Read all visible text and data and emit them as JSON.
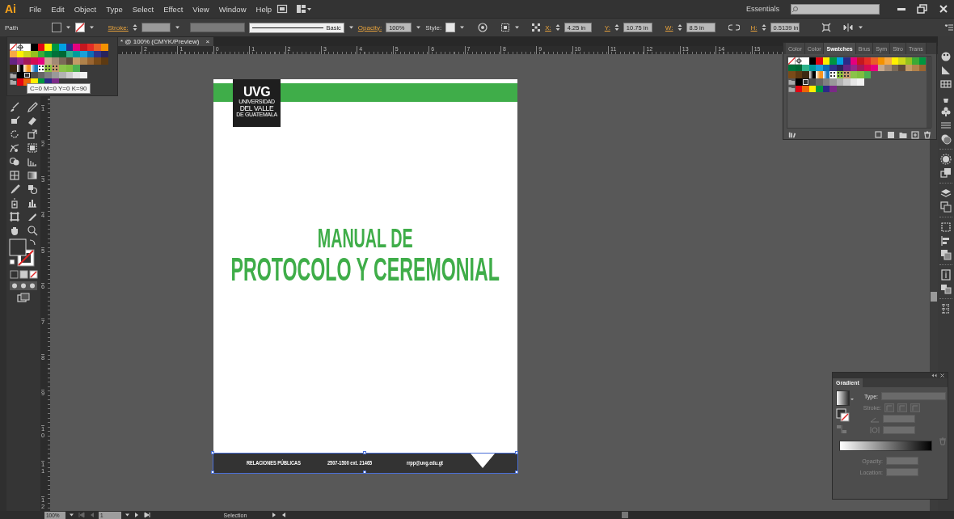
{
  "menu_bar": {
    "app_logo": "Ai",
    "items": [
      "File",
      "Edit",
      "Object",
      "Type",
      "Select",
      "Effect",
      "View",
      "Window",
      "Help"
    ],
    "workspace": "Essentials"
  },
  "control_bar": {
    "selection_type": "Path",
    "stroke_label": "Stroke:",
    "brush": "Basic",
    "opacity_label": "Opacity:",
    "opacity": "100%",
    "style_label": "Style:",
    "x_label": "X:",
    "x": "4.25 in",
    "y_label": "Y:",
    "y": "10.75 in",
    "w_label": "W:",
    "w": "8.5 in",
    "h_label": "H:",
    "h": "0.5139 in"
  },
  "document_tab": {
    "title": "* @ 100% (CMYK/Preview)",
    "close": "×"
  },
  "rulers": {
    "horizontal": [
      "2",
      "1",
      "0",
      "1",
      "2",
      "3",
      "4",
      "5",
      "6",
      "7",
      "8",
      "9",
      "10",
      "11",
      "12",
      "13",
      "14",
      "15"
    ],
    "vertical": [
      "1",
      "2",
      "3",
      "4",
      "5",
      "6",
      "7",
      "8",
      "9",
      "10",
      "11",
      "12"
    ]
  },
  "artboard": {
    "logo": {
      "initials": "UVG",
      "name_lines": [
        "UNIVERSIDAD",
        "DEL VALLE",
        "DE GUATEMALA"
      ]
    },
    "title_lines": [
      "MANUAL DE",
      "PROTOCOLO Y CEREMONIAL"
    ],
    "footer": [
      "RELACIONES PÚBLICAS",
      "2507-1500 ext. 21465",
      "rrpp@uvg.edu.gt"
    ]
  },
  "floating_swatches": {
    "rows": [
      {
        "kind": "plain",
        "swatches": [
          {
            "kind": "none",
            "selected": false
          },
          {
            "kind": "registration",
            "selected": false
          },
          {
            "kind": "solid",
            "color": "#ffffff",
            "selected": false
          },
          {
            "kind": "solid",
            "color": "#000000",
            "selected": false
          },
          {
            "kind": "solid",
            "color": "#e30613",
            "selected": false
          },
          {
            "kind": "solid",
            "color": "#ffed00",
            "selected": false
          },
          {
            "kind": "solid",
            "color": "#009640",
            "selected": false
          },
          {
            "kind": "solid",
            "color": "#00a0e3",
            "selected": false
          },
          {
            "kind": "solid",
            "color": "#2b2a87",
            "selected": false
          },
          {
            "kind": "solid",
            "color": "#e5007e",
            "selected": false
          },
          {
            "kind": "solid",
            "color": "#c5171f",
            "selected": false
          },
          {
            "kind": "solid",
            "color": "#e42d26",
            "selected": false
          },
          {
            "kind": "solid",
            "color": "#e95f27",
            "selected": false
          },
          {
            "kind": "solid",
            "color": "#f39200",
            "selected": false
          }
        ]
      },
      {
        "kind": "plain",
        "swatches": [
          {
            "kind": "solid",
            "color": "#f6a945",
            "selected": false
          },
          {
            "kind": "solid",
            "color": "#fff000",
            "selected": false
          },
          {
            "kind": "solid",
            "color": "#cdd61c",
            "selected": false
          },
          {
            "kind": "solid",
            "color": "#95c11f",
            "selected": false
          },
          {
            "kind": "solid",
            "color": "#3aaa35",
            "selected": false
          },
          {
            "kind": "solid",
            "color": "#009640",
            "selected": false
          },
          {
            "kind": "solid",
            "color": "#00713a",
            "selected": false
          },
          {
            "kind": "solid",
            "color": "#006835",
            "selected": false
          },
          {
            "kind": "solid",
            "color": "#2db28a",
            "selected": false
          },
          {
            "kind": "solid",
            "color": "#009a9b",
            "selected": false
          },
          {
            "kind": "solid",
            "color": "#1ba0d8",
            "selected": false
          },
          {
            "kind": "solid",
            "color": "#0c6db4",
            "selected": false
          },
          {
            "kind": "solid",
            "color": "#2e3289",
            "selected": false
          },
          {
            "kind": "solid",
            "color": "#29235c",
            "selected": false
          }
        ]
      },
      {
        "kind": "plain",
        "swatches": [
          {
            "kind": "solid",
            "color": "#662483",
            "selected": false
          },
          {
            "kind": "solid",
            "color": "#95278b",
            "selected": false
          },
          {
            "kind": "solid",
            "color": "#a3195b",
            "selected": false
          },
          {
            "kind": "solid",
            "color": "#d60b52",
            "selected": false
          },
          {
            "kind": "solid",
            "color": "#e6007e",
            "selected": false
          },
          {
            "kind": "solid",
            "color": "#c6a98c",
            "selected": false
          },
          {
            "kind": "solid",
            "color": "#a28a75",
            "selected": false
          },
          {
            "kind": "solid",
            "color": "#7b6a58",
            "selected": false
          },
          {
            "kind": "solid",
            "color": "#5f4b3b",
            "selected": false
          },
          {
            "kind": "solid",
            "color": "#c39a66",
            "selected": false
          },
          {
            "kind": "solid",
            "color": "#b1824b",
            "selected": false
          },
          {
            "kind": "solid",
            "color": "#9a6531",
            "selected": false
          },
          {
            "kind": "solid",
            "color": "#7a4b18",
            "selected": false
          },
          {
            "kind": "solid",
            "color": "#5d3a12",
            "selected": false
          }
        ]
      },
      {
        "kind": "plain",
        "swatches": [
          {
            "kind": "solid",
            "color": "#3d2a12",
            "selected": false
          },
          {
            "kind": "gradient",
            "color": "#000000",
            "selected": false
          },
          {
            "kind": "gradient",
            "color": "#f7941d",
            "selected": false
          },
          {
            "kind": "gradient",
            "color": "#1b75bc",
            "selected": false
          },
          {
            "kind": "pattern",
            "color": "#ffffff",
            "selected": false
          },
          {
            "kind": "pattern",
            "color": "#8dc63f",
            "selected": false
          },
          {
            "kind": "pattern",
            "color": "#c69c6d",
            "selected": false
          },
          {
            "kind": "solid",
            "color": "#8bc34a",
            "selected": false
          },
          {
            "kind": "solid",
            "color": "#7fbf3f",
            "selected": false
          },
          {
            "kind": "solid",
            "color": "#4caf50",
            "selected": false
          }
        ]
      },
      {
        "kind": "group",
        "swatches": [
          {
            "kind": "solid",
            "color": "#000000",
            "selected": false
          },
          {
            "kind": "solid",
            "color": "#333333",
            "selected": true
          },
          {
            "kind": "solid",
            "color": "#4d4d4d",
            "selected": false
          },
          {
            "kind": "solid",
            "color": "#666666",
            "selected": false
          },
          {
            "kind": "solid",
            "color": "#808080",
            "selected": false
          },
          {
            "kind": "solid",
            "color": "#999999",
            "selected": false
          },
          {
            "kind": "solid",
            "color": "#b3b3b3",
            "selected": false
          },
          {
            "kind": "solid",
            "color": "#cccccc",
            "selected": false
          },
          {
            "kind": "solid",
            "color": "#e6e6e6",
            "selected": false
          },
          {
            "kind": "solid",
            "color": "#f2f2f2",
            "selected": false
          }
        ]
      },
      {
        "kind": "group",
        "swatches": [
          {
            "kind": "solid",
            "color": "#e30613",
            "selected": false
          },
          {
            "kind": "solid",
            "color": "#ec6608",
            "selected": false
          },
          {
            "kind": "solid",
            "color": "#ffed00",
            "selected": false
          },
          {
            "kind": "solid",
            "color": "#009640",
            "selected": false
          },
          {
            "kind": "solid",
            "color": "#2b2a87",
            "selected": false
          },
          {
            "kind": "solid",
            "color": "#7b2a87",
            "selected": false
          }
        ]
      }
    ]
  },
  "tooltip": "C=0 M=0 Y=0 K=90",
  "swatches_panel": {
    "tabs": [
      {
        "label": "Color",
        "selected": false
      },
      {
        "label": "Color",
        "selected": false
      },
      {
        "label": "Swatches",
        "selected": true
      },
      {
        "label": "Brus",
        "selected": false
      },
      {
        "label": "Sym",
        "selected": false
      },
      {
        "label": "Stro",
        "selected": false
      },
      {
        "label": "Trans",
        "selected": false
      }
    ],
    "rows": [
      {
        "kind": "plain",
        "swatches": [
          {
            "kind": "none",
            "selected": false
          },
          {
            "kind": "registration",
            "selected": false
          },
          {
            "kind": "solid",
            "color": "#ffffff",
            "selected": false
          },
          {
            "kind": "solid",
            "color": "#000000",
            "selected": false
          },
          {
            "kind": "solid",
            "color": "#e30613",
            "selected": false
          },
          {
            "kind": "solid",
            "color": "#ffed00",
            "selected": false
          },
          {
            "kind": "solid",
            "color": "#009640",
            "selected": false
          },
          {
            "kind": "solid",
            "color": "#00a0e3",
            "selected": false
          },
          {
            "kind": "solid",
            "color": "#2b2a87",
            "selected": false
          },
          {
            "kind": "solid",
            "color": "#e5007e",
            "selected": false
          },
          {
            "kind": "solid",
            "color": "#c5171f",
            "selected": false
          },
          {
            "kind": "solid",
            "color": "#e42d26",
            "selected": false
          },
          {
            "kind": "solid",
            "color": "#e95f27",
            "selected": false
          },
          {
            "kind": "solid",
            "color": "#f39200",
            "selected": false
          },
          {
            "kind": "solid",
            "color": "#f6a945",
            "selected": false
          },
          {
            "kind": "solid",
            "color": "#fff000",
            "selected": false
          },
          {
            "kind": "solid",
            "color": "#cdd61c",
            "selected": false
          },
          {
            "kind": "solid",
            "color": "#95c11f",
            "selected": false
          },
          {
            "kind": "solid",
            "color": "#3aaa35",
            "selected": false
          },
          {
            "kind": "solid",
            "color": "#009640",
            "selected": false
          }
        ]
      },
      {
        "kind": "plain",
        "swatches": [
          {
            "kind": "solid",
            "color": "#00713a",
            "selected": false
          },
          {
            "kind": "solid",
            "color": "#006835",
            "selected": false
          },
          {
            "kind": "solid",
            "color": "#2db28a",
            "selected": false
          },
          {
            "kind": "solid",
            "color": "#009a9b",
            "selected": false
          },
          {
            "kind": "solid",
            "color": "#1ba0d8",
            "selected": false
          },
          {
            "kind": "solid",
            "color": "#0c6db4",
            "selected": false
          },
          {
            "kind": "solid",
            "color": "#2e3289",
            "selected": false
          },
          {
            "kind": "solid",
            "color": "#29235c",
            "selected": false
          },
          {
            "kind": "solid",
            "color": "#662483",
            "selected": false
          },
          {
            "kind": "solid",
            "color": "#95278b",
            "selected": false
          },
          {
            "kind": "solid",
            "color": "#a3195b",
            "selected": false
          },
          {
            "kind": "solid",
            "color": "#d60b52",
            "selected": false
          },
          {
            "kind": "solid",
            "color": "#e6007e",
            "selected": false
          },
          {
            "kind": "solid",
            "color": "#c6a98c",
            "selected": false
          },
          {
            "kind": "solid",
            "color": "#a28a75",
            "selected": false
          },
          {
            "kind": "solid",
            "color": "#7b6a58",
            "selected": false
          },
          {
            "kind": "solid",
            "color": "#5f4b3b",
            "selected": false
          },
          {
            "kind": "solid",
            "color": "#c39a66",
            "selected": false
          },
          {
            "kind": "solid",
            "color": "#b1824b",
            "selected": false
          },
          {
            "kind": "solid",
            "color": "#9a6531",
            "selected": false
          }
        ]
      },
      {
        "kind": "plain",
        "swatches": [
          {
            "kind": "solid",
            "color": "#7a4b18",
            "selected": false
          },
          {
            "kind": "solid",
            "color": "#5d3a12",
            "selected": false
          },
          {
            "kind": "solid",
            "color": "#3d2a12",
            "selected": false
          },
          {
            "kind": "gradient",
            "color": "#000000",
            "selected": false
          },
          {
            "kind": "gradient",
            "color": "#f7941d",
            "selected": false
          },
          {
            "kind": "gradient",
            "color": "#1b75bc",
            "selected": false
          },
          {
            "kind": "pattern",
            "color": "#ffffff",
            "selected": false
          },
          {
            "kind": "pattern",
            "color": "#8dc63f",
            "selected": false
          },
          {
            "kind": "pattern",
            "color": "#c69c6d",
            "selected": false
          },
          {
            "kind": "solid",
            "color": "#8bc34a",
            "selected": false
          },
          {
            "kind": "solid",
            "color": "#7fbf3f",
            "selected": false
          },
          {
            "kind": "solid",
            "color": "#4caf50",
            "selected": false
          }
        ]
      },
      {
        "kind": "group",
        "swatches": [
          {
            "kind": "solid",
            "color": "#000000",
            "selected": false
          },
          {
            "kind": "solid",
            "color": "#333333",
            "selected": true
          },
          {
            "kind": "solid",
            "color": "#4d4d4d",
            "selected": false
          },
          {
            "kind": "solid",
            "color": "#666666",
            "selected": false
          },
          {
            "kind": "solid",
            "color": "#808080",
            "selected": false
          },
          {
            "kind": "solid",
            "color": "#999999",
            "selected": false
          },
          {
            "kind": "solid",
            "color": "#b3b3b3",
            "selected": false
          },
          {
            "kind": "solid",
            "color": "#cccccc",
            "selected": false
          },
          {
            "kind": "solid",
            "color": "#e6e6e6",
            "selected": false
          },
          {
            "kind": "solid",
            "color": "#f2f2f2",
            "selected": false
          }
        ]
      },
      {
        "kind": "group",
        "swatches": [
          {
            "kind": "solid",
            "color": "#e30613",
            "selected": false
          },
          {
            "kind": "solid",
            "color": "#ec6608",
            "selected": false
          },
          {
            "kind": "solid",
            "color": "#ffed00",
            "selected": false
          },
          {
            "kind": "solid",
            "color": "#009640",
            "selected": false
          },
          {
            "kind": "solid",
            "color": "#2b2a87",
            "selected": false
          },
          {
            "kind": "solid",
            "color": "#7b2a87",
            "selected": false
          }
        ]
      }
    ]
  },
  "gradient_panel": {
    "title": "Gradient",
    "type_label": "Type:",
    "stroke_label": "Stroke:",
    "opacity_label": "Opacity:",
    "location_label": "Location:"
  },
  "status_bar": {
    "zoom": "100%",
    "page": "1",
    "tool": "Selection"
  }
}
